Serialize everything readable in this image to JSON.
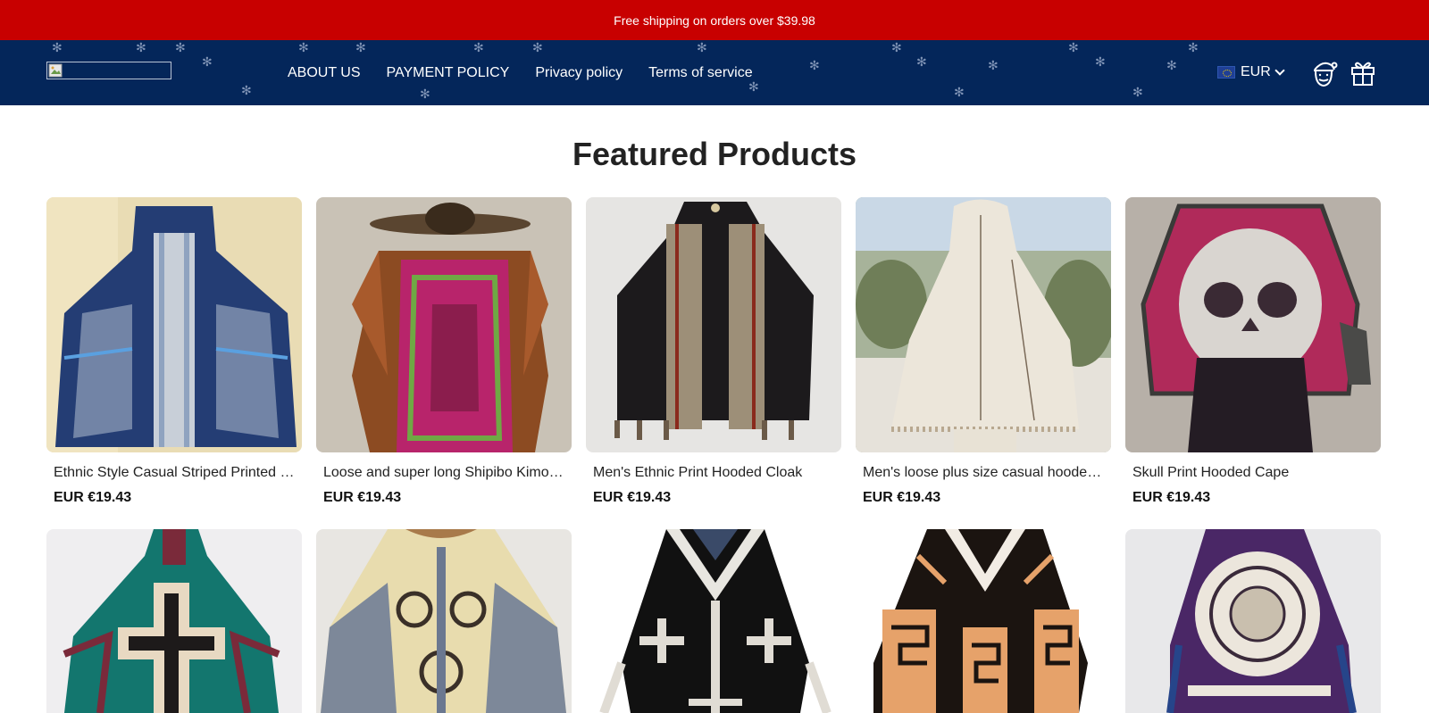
{
  "announcement": "Free shipping on orders over $39.98",
  "nav": [
    "ABOUT US",
    "PAYMENT POLICY",
    "Privacy policy",
    "Terms of service"
  ],
  "currency": "EUR",
  "section_title": "Featured Products",
  "products": [
    {
      "title": "Ethnic Style Casual Striped Printed Hooded Cloak",
      "price": "EUR €19.43"
    },
    {
      "title": "Loose and super long Shipibo Kimono",
      "price": "EUR €19.43"
    },
    {
      "title": "Men's Ethnic Print Hooded Cloak",
      "price": "EUR €19.43"
    },
    {
      "title": "Men's loose plus size casual hooded cloak",
      "price": "EUR €19.43"
    },
    {
      "title": "Skull Print Hooded Cape",
      "price": "EUR €19.43"
    }
  ],
  "colors": {
    "announcement_bg": "#c80000",
    "header_bg": "#04265a"
  }
}
